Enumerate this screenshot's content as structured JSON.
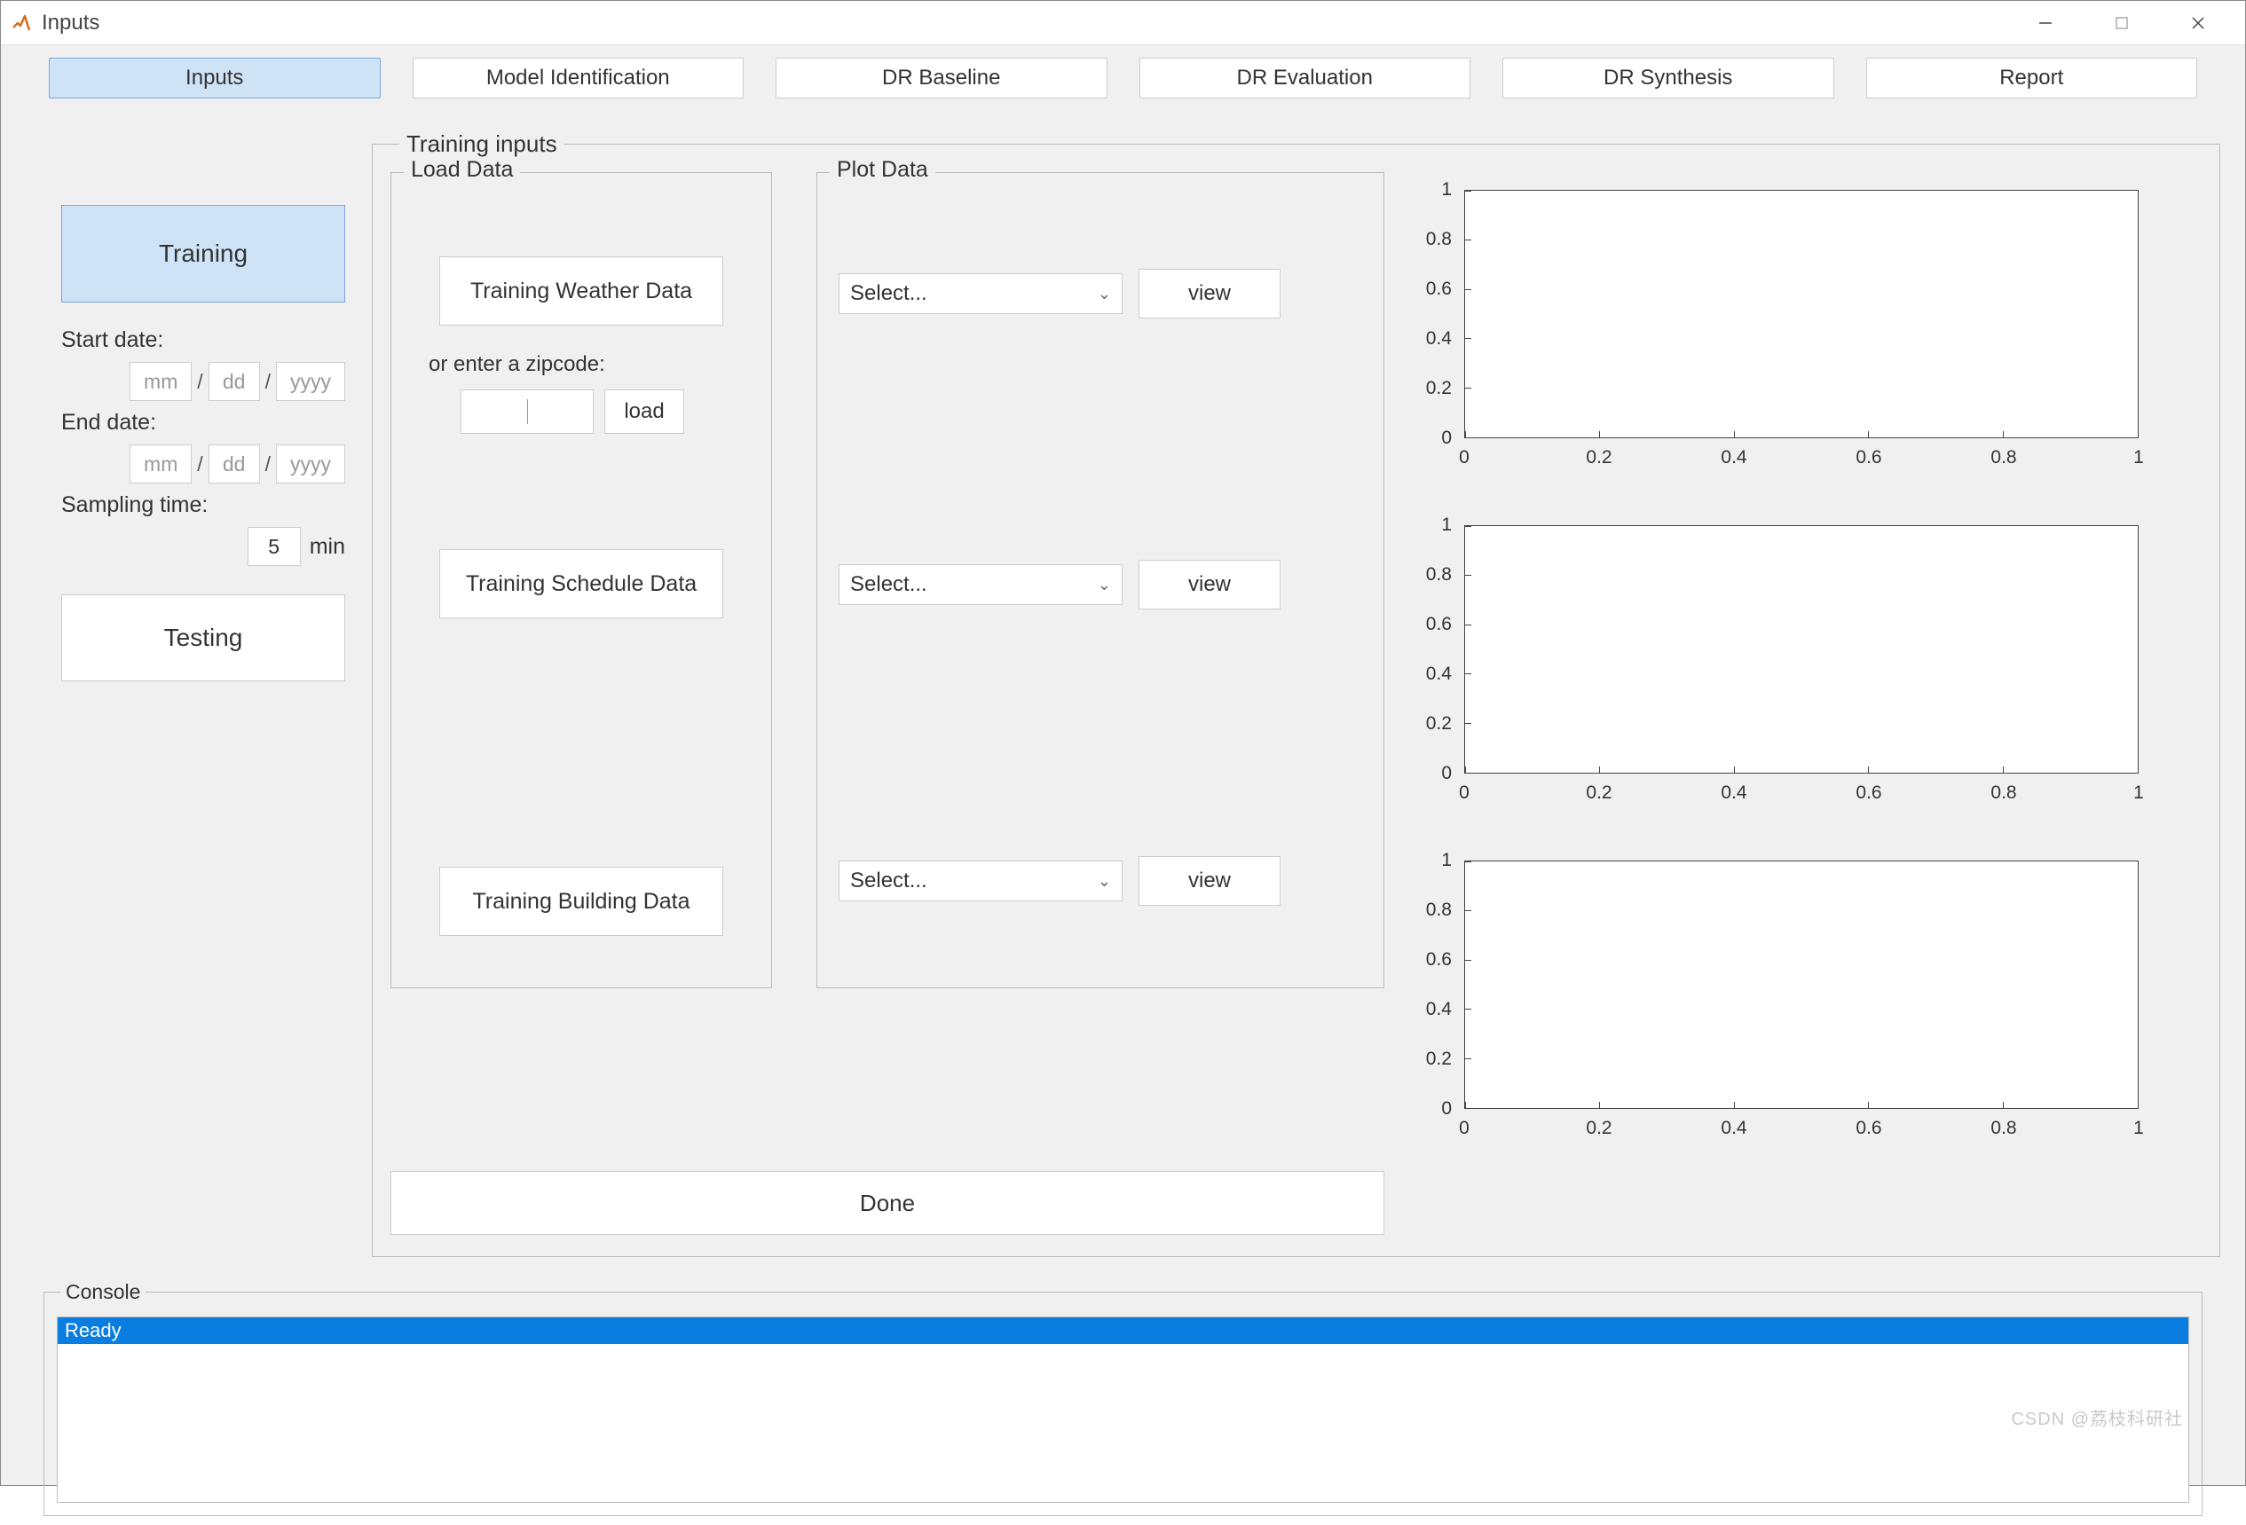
{
  "window": {
    "title": "Inputs"
  },
  "nav": {
    "tabs": [
      {
        "label": "Inputs",
        "active": true
      },
      {
        "label": "Model Identification"
      },
      {
        "label": "DR Baseline"
      },
      {
        "label": "DR Evaluation"
      },
      {
        "label": "DR Synthesis"
      },
      {
        "label": "Report"
      }
    ]
  },
  "left": {
    "training_btn": "Training",
    "testing_btn": "Testing",
    "start_label": "Start date:",
    "end_label": "End date:",
    "sampling_label": "Sampling time:",
    "sampling_value": "5",
    "sampling_unit": "min",
    "date_placeholders": {
      "mm": "mm",
      "dd": "dd",
      "yyyy": "yyyy"
    }
  },
  "training_inputs": {
    "legend": "Training inputs",
    "load_data": {
      "legend": "Load Data",
      "weather_btn": "Training Weather Data",
      "zip_hint": "or enter a zipcode:",
      "zip_value": "",
      "zip_load_btn": "load",
      "schedule_btn": "Training Schedule Data",
      "building_btn": "Training Building Data"
    },
    "plot_data": {
      "legend": "Plot Data",
      "select_placeholder": "Select...",
      "view_btn": "view"
    },
    "done_btn": "Done"
  },
  "chart_data": [
    {
      "type": "line",
      "x": [],
      "y": [],
      "xlim": [
        0,
        1
      ],
      "ylim": [
        0,
        1
      ],
      "xticks": [
        0,
        0.2,
        0.4,
        0.6,
        0.8,
        1
      ],
      "yticks": [
        0,
        0.2,
        0.4,
        0.6,
        0.8,
        1
      ],
      "title": "",
      "xlabel": "",
      "ylabel": ""
    },
    {
      "type": "line",
      "x": [],
      "y": [],
      "xlim": [
        0,
        1
      ],
      "ylim": [
        0,
        1
      ],
      "xticks": [
        0,
        0.2,
        0.4,
        0.6,
        0.8,
        1
      ],
      "yticks": [
        0,
        0.2,
        0.4,
        0.6,
        0.8,
        1
      ],
      "title": "",
      "xlabel": "",
      "ylabel": ""
    },
    {
      "type": "line",
      "x": [],
      "y": [],
      "xlim": [
        0,
        1
      ],
      "ylim": [
        0,
        1
      ],
      "xticks": [
        0,
        0.2,
        0.4,
        0.6,
        0.8,
        1
      ],
      "yticks": [
        0,
        0.2,
        0.4,
        0.6,
        0.8,
        1
      ],
      "title": "",
      "xlabel": "",
      "ylabel": ""
    }
  ],
  "console": {
    "legend": "Console",
    "lines": [
      "Ready"
    ]
  },
  "watermark": "CSDN @荔枝科研社"
}
